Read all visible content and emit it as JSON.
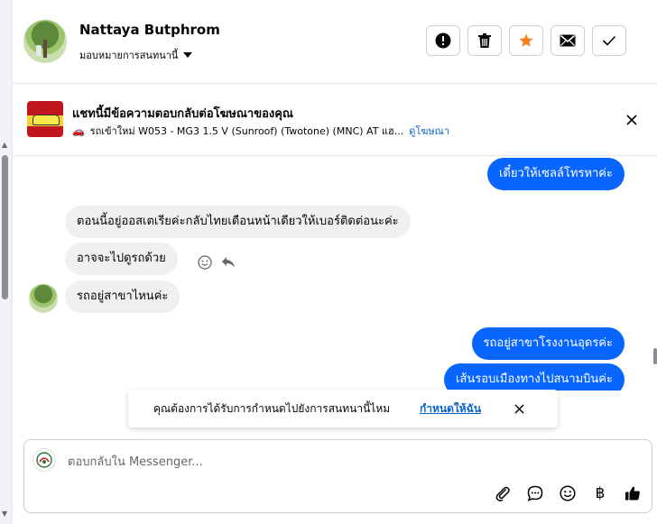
{
  "header": {
    "user_name": "Nattaya Butphrom",
    "assign_label": "มอบหมายการสนทนานี้",
    "actions": [
      "spam-icon",
      "trash-icon",
      "star-icon",
      "mail-icon",
      "check-icon"
    ],
    "star_color": "#f5821f"
  },
  "ad": {
    "title": "แชทนี้มีข้อความตอบกลับต่อโฆษณาของคุณ",
    "car_emoji": "🚗",
    "subtitle": "รถเข้าใหม่ W053 - MG3 1.5 V (Sunroof) (Twotone) (MNC) AT แฮ...",
    "link": "ดูโฆษณา"
  },
  "messages": [
    {
      "side": "out",
      "text": "เดี๋ยวให้เซลล์โทรหาค่ะ"
    },
    {
      "side": "in",
      "text": "ตอนนี้อยู่ออสเตเรียค่ะกลับไทยเดือนหน้าเดียวให้เบอร์ติดต่อนะค่ะ"
    },
    {
      "side": "in",
      "text": "อาจจะไปดูรถด้วย"
    },
    {
      "side": "in",
      "text": "รถอยู่สาขาไหนค่ะ"
    },
    {
      "side": "out",
      "text": "รถอยู่สาขาโรงงานอุดรค่ะ"
    },
    {
      "side": "out",
      "text": "เส้นรอบเมืองทางไปสนามบินค่ะ"
    }
  ],
  "toast": {
    "text": "คุณต้องการได้รับการกำหนดไปยังการสนทนานี้ไหม",
    "link": "กำหนดให้ฉัน"
  },
  "composer": {
    "placeholder": "ตอบกลับใน Messenger...",
    "tools": [
      "attach-icon",
      "chat-bubble-icon",
      "emoji-icon",
      "baht-icon",
      "thumbs-up-icon"
    ],
    "baht_symbol": "฿"
  },
  "colors": {
    "accent": "#0866ff",
    "incoming_bg": "#f0f0f0",
    "link": "#0a62c9"
  }
}
